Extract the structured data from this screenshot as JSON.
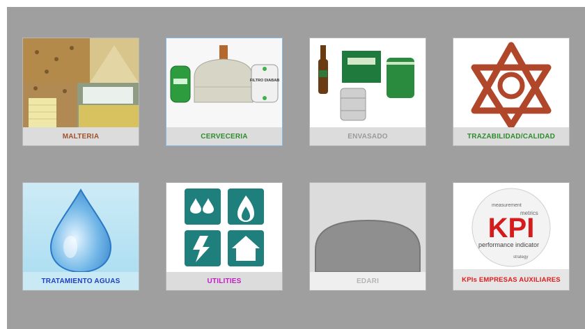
{
  "tiles": [
    {
      "id": "malteria",
      "label": "MALTERIA",
      "color": "#a0522d"
    },
    {
      "id": "cerveceria",
      "label": "CERVECERIA",
      "color": "#2e8b2e"
    },
    {
      "id": "envasado",
      "label": "ENVASADO",
      "color": "#9a9a9a"
    },
    {
      "id": "trazabilidad",
      "label": "TRAZABILIDAD/CALIDAD",
      "color": "#2e8b2e"
    },
    {
      "id": "tratamiento",
      "label": "TRATAMIENTO AGUAS",
      "color": "#1f3fbf"
    },
    {
      "id": "utilities",
      "label": "UTILITIES",
      "color": "#c21cc2"
    },
    {
      "id": "edari",
      "label": "EDARI",
      "color": "#b5b5b5"
    },
    {
      "id": "kpis",
      "label": "KPIs EMPRESAS AUXILIARES",
      "color": "#e01b1b"
    }
  ],
  "cerveceria_art": {
    "filtro_text": "FILTRO DIABAB"
  },
  "kpi_art": {
    "big_text": "KPI",
    "words": [
      "performance indicator",
      "metrics",
      "measurement",
      "strategy"
    ]
  }
}
